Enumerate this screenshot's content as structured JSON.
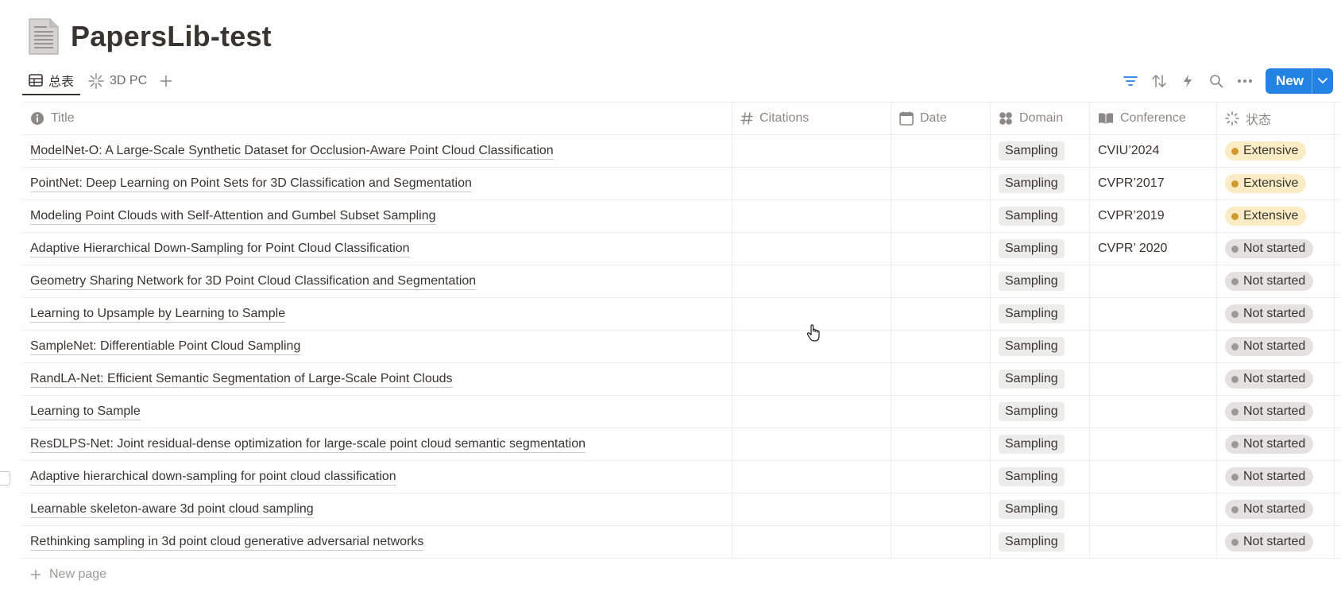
{
  "page": {
    "title": "PapersLib-test"
  },
  "tabs": [
    {
      "label": "总表",
      "icon": "table-icon",
      "active": true
    },
    {
      "label": "3D PC",
      "icon": "sparkle-icon",
      "active": false
    }
  ],
  "toolbar": {
    "new_label": "New"
  },
  "columns": {
    "title": "Title",
    "citations": "Citations",
    "date": "Date",
    "domain": "Domain",
    "conference": "Conference",
    "status": "状态"
  },
  "colors": {
    "accent": "#2383e2",
    "extensive_bg": "#fbecc5",
    "extensive_dot": "#d29a2c",
    "notstarted_bg": "#e3e2e0",
    "notstarted_dot": "#9b9a97"
  },
  "rows": [
    {
      "title": "ModelNet-O: A Large-Scale Synthetic Dataset for Occlusion-Aware Point Cloud Classification",
      "citations": "",
      "date": "",
      "domain": "Sampling",
      "conference": "CVIU’2024",
      "status": "Extensive"
    },
    {
      "title": "PointNet: Deep Learning on Point Sets for 3D Classification and Segmentation",
      "citations": "",
      "date": "",
      "domain": "Sampling",
      "conference": "CVPR’2017",
      "status": "Extensive"
    },
    {
      "title": "Modeling Point Clouds with Self-Attention and Gumbel Subset Sampling",
      "citations": "",
      "date": "",
      "domain": "Sampling",
      "conference": "CVPR’2019",
      "status": "Extensive"
    },
    {
      "title": "Adaptive Hierarchical Down-Sampling for Point Cloud Classification",
      "citations": "",
      "date": "",
      "domain": "Sampling",
      "conference": "CVPR’ 2020",
      "status": "Not started"
    },
    {
      "title": "Geometry Sharing Network for 3D Point Cloud Classification and Segmentation",
      "citations": "",
      "date": "",
      "domain": "Sampling",
      "conference": "",
      "status": "Not started"
    },
    {
      "title": "Learning to Upsample by Learning to Sample",
      "citations": "",
      "date": "",
      "domain": "Sampling",
      "conference": "",
      "status": "Not started"
    },
    {
      "title": "SampleNet: Differentiable Point Cloud Sampling",
      "citations": "",
      "date": "",
      "domain": "Sampling",
      "conference": "",
      "status": "Not started"
    },
    {
      "title": "RandLA-Net: Efficient Semantic Segmentation of Large-Scale Point Clouds",
      "citations": "",
      "date": "",
      "domain": "Sampling",
      "conference": "",
      "status": "Not started"
    },
    {
      "title": "Learning to Sample",
      "citations": "",
      "date": "",
      "domain": "Sampling",
      "conference": "",
      "status": "Not started"
    },
    {
      "title": "ResDLPS-Net: Joint residual-dense optimization for large-scale point cloud semantic segmentation",
      "citations": "",
      "date": "",
      "domain": "Sampling",
      "conference": "",
      "status": "Not started"
    },
    {
      "title": "Adaptive hierarchical down-sampling for point cloud classification",
      "citations": "",
      "date": "",
      "domain": "Sampling",
      "conference": "",
      "status": "Not started"
    },
    {
      "title": "Learnable skeleton-aware 3d point cloud sampling",
      "citations": "",
      "date": "",
      "domain": "Sampling",
      "conference": "",
      "status": "Not started"
    },
    {
      "title": "Rethinking sampling in 3d point cloud generative adversarial networks",
      "citations": "",
      "date": "",
      "domain": "Sampling",
      "conference": "",
      "status": "Not started"
    }
  ],
  "footer": {
    "new_page_label": "New page"
  }
}
